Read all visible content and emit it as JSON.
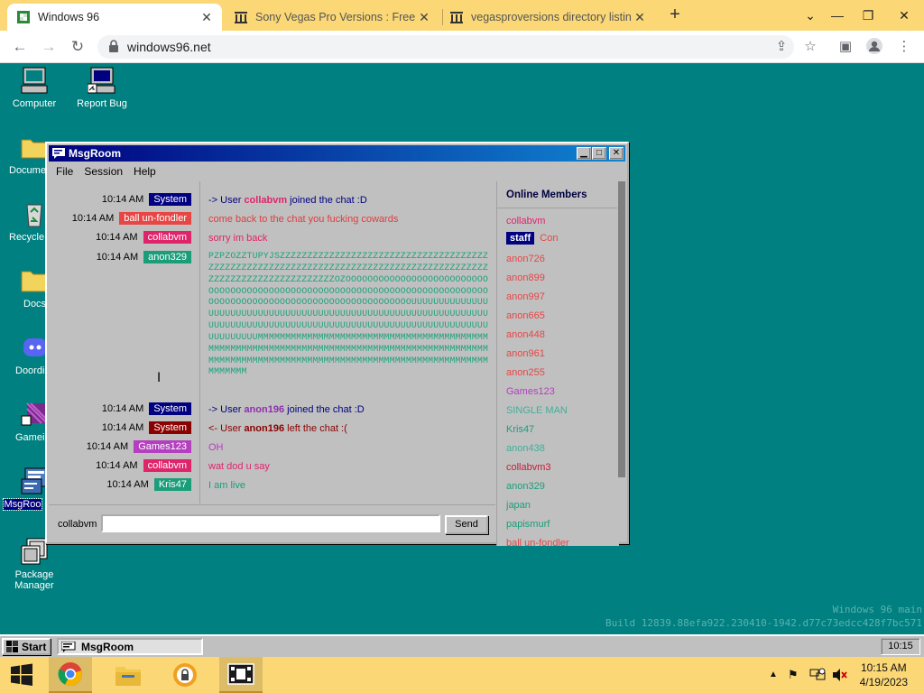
{
  "browser": {
    "tabs": [
      {
        "title": "Windows 96",
        "active": true
      },
      {
        "title": "Sony Vegas Pro Versions : Free D",
        "active": false
      },
      {
        "title": "vegasproversions directory listin",
        "active": false
      }
    ],
    "url": "windows96.net"
  },
  "desktop": {
    "icons": [
      {
        "label": "Computer",
        "icon": "computer-icon"
      },
      {
        "label": "Report Bug",
        "icon": "report-bug-icon"
      },
      {
        "label": "Docume",
        "icon": "folder-icon"
      },
      {
        "label": "Recycle",
        "icon": "recycle-bin-icon"
      },
      {
        "label": "Docs",
        "icon": "folder-icon"
      },
      {
        "label": "Doordi",
        "icon": "discord-icon"
      },
      {
        "label": "Gamein",
        "icon": "game-icon"
      },
      {
        "label": "MsgRoo",
        "icon": "msgroom-icon"
      },
      {
        "label": "Package Manager",
        "icon": "package-icon"
      }
    ],
    "build_line1": "Windows 96 main",
    "build_line2": "Build 12839.88efa922.230410-1942.d77c73edcc428f7bc571"
  },
  "msgroom": {
    "title": "MsgRoom",
    "menu": [
      "File",
      "Session",
      "Help"
    ],
    "messages": [
      {
        "time": "10:14 AM",
        "user": "System",
        "user_color": "#000080",
        "text_parts": [
          "-> User ",
          "collabvm",
          " joined the chat :D"
        ],
        "text_color": "#000080",
        "highlight_color": "#e0246a"
      },
      {
        "time": "10:14 AM",
        "user": "ball un-fondler",
        "user_color": "#e84545",
        "text": "come back to the chat you fucking cowards",
        "text_color": "#e03d3d"
      },
      {
        "time": "10:14 AM",
        "user": "collabvm",
        "user_color": "#e0246a",
        "text": "sorry im back",
        "text_color": "#e0246a"
      },
      {
        "time": "10:14 AM",
        "user": "anon329",
        "user_color": "#1a9e7a",
        "text": "PZPZOZZTUPYJSZZZZZZZZZZZZZZZZZZZZZZZZZZZZZZZZZZZZZZZZZZZZZZZZZZZZZZZZZZZZZZZZZZZZZZZZZZZZZZZZZZZZZZZZZZZZZZZZZZZZZZZZZZZZZZZZOZOOOOOOOOOOOOOOOOOOOOOOOOOOOOOOOOOOOOOOOOOOOOOOOOOOOOOOOOOOOOOOOOOOOOOOOOOOOOOOOOOOOOOOOOOOOOOOOOOOOOOOOOOOOOOOOOOOUUUUUUUUUUUUUUUUUUUUUUUUUUUUUUUUUUUUUUUUUUUUUUUUUUUUUUUUUUUUUUUUUUUUUUUUUUUUUUUUUUUUUUUUUUUUUUUUUUUUUUUUUUUUUUUUUUUUUUUUUUUUUMMMMMMMMMMMMMMMMMMMMMMMMMMMMMMMMMMMMMMMMMMMMMMMMMMMMMMMMMMMMMMMMMMMMMMMMMMMMMMMMMMMMMMMMMMMMMMMMMMMMMMMMMMMMMMMMMMMMMMMMMMMMMMMMMMMMMMMMMMMMMMMMMMMMMMM",
        "text_color": "#1a9e7a"
      },
      {
        "time": "10:14 AM",
        "user": "System",
        "user_color": "#000080",
        "text_parts": [
          "-> User ",
          "anon196",
          " joined the chat :D"
        ],
        "text_color": "#000080",
        "highlight_color": "#8e2fae"
      },
      {
        "time": "10:14 AM",
        "user": "System",
        "user_color": "#8b0000",
        "text_parts": [
          "<- User ",
          "anon196",
          " left the chat :("
        ],
        "text_color": "#8b0000",
        "highlight_color": "#8b0000"
      },
      {
        "time": "10:14 AM",
        "user": "Games123",
        "user_color": "#b43fbf",
        "text": "OH",
        "text_color": "#b43fbf"
      },
      {
        "time": "10:14 AM",
        "user": "collabvm",
        "user_color": "#e0246a",
        "text": "wat dod u say",
        "text_color": "#e0246a"
      },
      {
        "time": "10:14 AM",
        "user": "Kris47",
        "user_color": "#1a9e7a",
        "text": "I am live",
        "text_color": "#1a9e7a"
      }
    ],
    "members_header": "Online Members",
    "members": [
      {
        "name": "collabvm",
        "color": "#e0246a"
      },
      {
        "name": "Con",
        "color": "#e84545",
        "badge": "staff"
      },
      {
        "name": "anon726",
        "color": "#e84545"
      },
      {
        "name": "anon899",
        "color": "#e84545"
      },
      {
        "name": "anon997",
        "color": "#e84545"
      },
      {
        "name": "anon665",
        "color": "#e84545"
      },
      {
        "name": "anon448",
        "color": "#e84545"
      },
      {
        "name": "anon961",
        "color": "#e84545"
      },
      {
        "name": "anon255",
        "color": "#e84545"
      },
      {
        "name": "Games123",
        "color": "#b43fbf"
      },
      {
        "name": "SINGLE MAN",
        "color": "#3fb09a"
      },
      {
        "name": "Kris47",
        "color": "#1a9e7a"
      },
      {
        "name": "anon438",
        "color": "#3fb09a"
      },
      {
        "name": "collabvm3",
        "color": "#c0203a"
      },
      {
        "name": "anon329",
        "color": "#1a9e7a"
      },
      {
        "name": "japan",
        "color": "#1a9e7a"
      },
      {
        "name": "papismurf",
        "color": "#1a9e7a"
      },
      {
        "name": "ball un-fondler",
        "color": "#e84545"
      }
    ],
    "nick": "collabvm",
    "input_value": "",
    "send_label": "Send"
  },
  "taskbar96": {
    "start_label": "Start",
    "task_label": "MsgRoom",
    "clock": "10:15"
  },
  "hostbar": {
    "time": "10:15 AM",
    "date": "4/19/2023"
  }
}
